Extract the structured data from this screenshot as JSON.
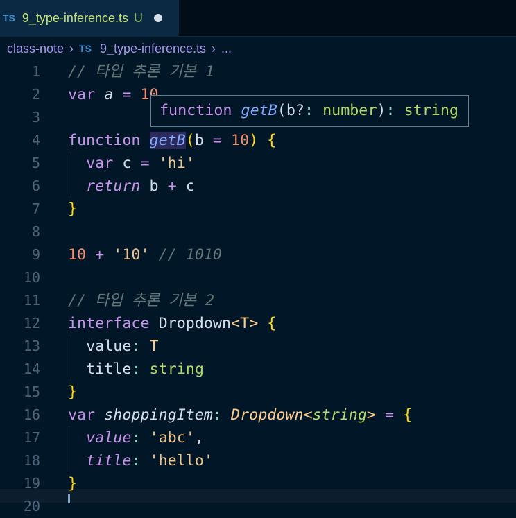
{
  "tab": {
    "icon": "TS",
    "filename": "9_type-inference.ts",
    "status": "U"
  },
  "breadcrumb": {
    "folder": "class-note",
    "icon": "TS",
    "file": "9_type-inference.ts",
    "more": "..."
  },
  "colors": {
    "background": "#011627",
    "keyword": "#c792ea",
    "function": "#82aaff",
    "number": "#f78c6c",
    "string": "#ecc48d",
    "type": "#addb67",
    "comment": "#637777"
  },
  "editor": {
    "lines": [
      {
        "n": "1",
        "t": [
          [
            "// 타입 추론 기본 1",
            "cm"
          ]
        ]
      },
      {
        "n": "2",
        "t": [
          [
            "var ",
            "kw"
          ],
          [
            "a",
            "vari"
          ],
          [
            " = ",
            "op"
          ],
          [
            "10",
            "num"
          ]
        ]
      },
      {
        "n": "3",
        "t": []
      },
      {
        "n": "4",
        "t": [
          [
            "function ",
            "kw"
          ],
          [
            "getB",
            "fn hl"
          ],
          [
            "(",
            "br"
          ],
          [
            "b",
            "var"
          ],
          [
            " = ",
            "op"
          ],
          [
            "10",
            "num"
          ],
          [
            ")",
            "br"
          ],
          [
            " ",
            "var"
          ],
          [
            "{",
            "br"
          ]
        ]
      },
      {
        "n": "5",
        "t": [
          [
            "  var ",
            "kw"
          ],
          [
            "c",
            "var"
          ],
          [
            " = ",
            "op"
          ],
          [
            "'",
            "str"
          ],
          [
            "hi",
            "str"
          ],
          [
            "'",
            "str"
          ]
        ]
      },
      {
        "n": "6",
        "t": [
          [
            "  return",
            "kwi"
          ],
          [
            " b ",
            "var"
          ],
          [
            "+",
            "op"
          ],
          [
            " c",
            "var"
          ]
        ]
      },
      {
        "n": "7",
        "t": [
          [
            "}",
            "br"
          ]
        ]
      },
      {
        "n": "8",
        "t": []
      },
      {
        "n": "9",
        "t": [
          [
            "10",
            "num"
          ],
          [
            " + ",
            "op"
          ],
          [
            "'10'",
            "str"
          ],
          [
            " // 1010",
            "cm"
          ]
        ]
      },
      {
        "n": "10",
        "t": []
      },
      {
        "n": "11",
        "t": [
          [
            "// 타입 추론 기본 2",
            "cm"
          ]
        ]
      },
      {
        "n": "12",
        "t": [
          [
            "interface ",
            "kw"
          ],
          [
            "Dropdown",
            "var"
          ],
          [
            "<",
            "tp"
          ],
          [
            "T",
            "tp"
          ],
          [
            ">",
            "tp"
          ],
          [
            " ",
            "var"
          ],
          [
            "{",
            "br"
          ]
        ]
      },
      {
        "n": "13",
        "t": [
          [
            "  value",
            "var"
          ],
          [
            ": ",
            "punc"
          ],
          [
            "T",
            "tp"
          ]
        ]
      },
      {
        "n": "14",
        "t": [
          [
            "  title",
            "var"
          ],
          [
            ": ",
            "punc"
          ],
          [
            "string",
            "type"
          ]
        ]
      },
      {
        "n": "15",
        "t": [
          [
            "}",
            "br"
          ]
        ]
      },
      {
        "n": "16",
        "t": [
          [
            "var ",
            "kw"
          ],
          [
            "shoppingItem",
            "vari"
          ],
          [
            ": ",
            "punc"
          ],
          [
            "Dropdown",
            "cls"
          ],
          [
            "<",
            "tp"
          ],
          [
            "string",
            "typei"
          ],
          [
            ">",
            "tp"
          ],
          [
            " = ",
            "op"
          ],
          [
            "{",
            "br"
          ]
        ]
      },
      {
        "n": "17",
        "t": [
          [
            "  value",
            "prop"
          ],
          [
            ": ",
            "punc"
          ],
          [
            "'abc'",
            "str"
          ],
          [
            ",",
            "var"
          ]
        ]
      },
      {
        "n": "18",
        "t": [
          [
            "  title",
            "prop"
          ],
          [
            ": ",
            "punc"
          ],
          [
            "'hello'",
            "str"
          ]
        ]
      },
      {
        "n": "19",
        "t": [
          [
            "}",
            "br"
          ]
        ]
      },
      {
        "n": "20",
        "t": []
      }
    ]
  },
  "hover": {
    "keyword": "function",
    "name": "getB",
    "open": "(",
    "param": "b?",
    "colon1": ": ",
    "ptype": "number",
    "close": ")",
    "colon2": ": ",
    "rtype": "string"
  }
}
